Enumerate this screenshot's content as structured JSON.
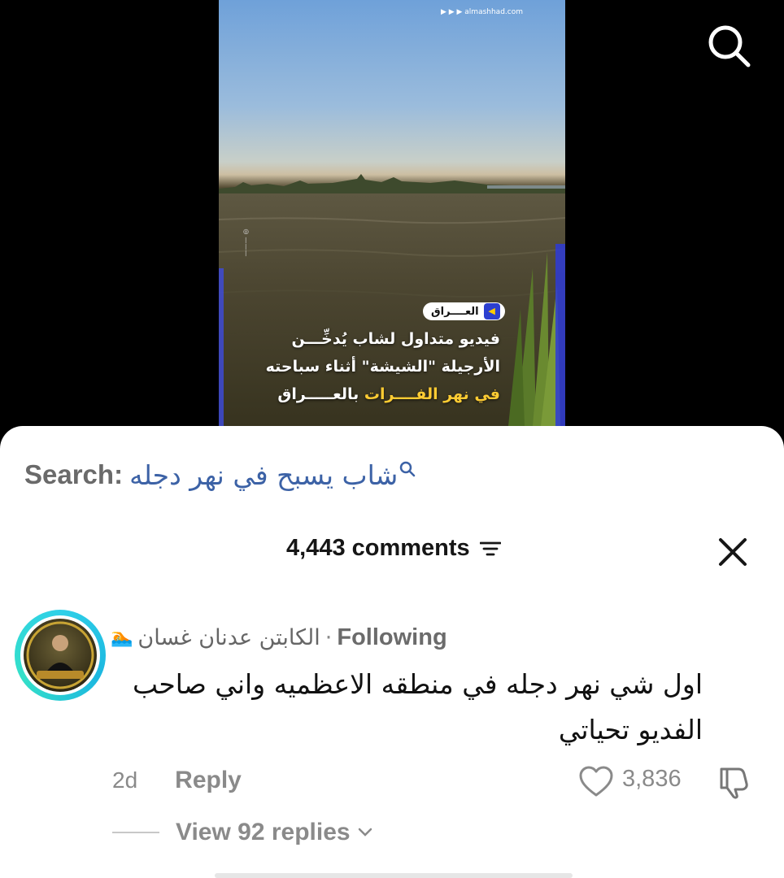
{
  "video": {
    "logo_domain": "▶ ▶ ▶ almashhad.com",
    "tag": "العــــراق",
    "headline_line1": "فيديو متداول لشاب يُدخِّـــن",
    "headline_line2": "الأرجيلة \"الشيشة\" أثناء سباحته",
    "headline_line3_prefix": "في نهر الفــــرات",
    "headline_line3_suffix": " بالعـــــراق",
    "highlight_color": "#ffcc33"
  },
  "search": {
    "label": "Search:",
    "term": "شاب يسبح في نهر دجله"
  },
  "comments": {
    "count_label": "4,443 comments"
  },
  "comment": {
    "username": "الكابتن عدنان غسان",
    "follow_status": "Following",
    "text": "اول شي نهر دجله في منطقه الاعظميه واني صاحب الفديو تحياتي",
    "age": "2d",
    "reply_label": "Reply",
    "likes": "3,836",
    "view_replies": "View 92 replies"
  },
  "colors": {
    "accent_link": "#3c62a6",
    "avatar_ring": "#2fd0e8"
  }
}
